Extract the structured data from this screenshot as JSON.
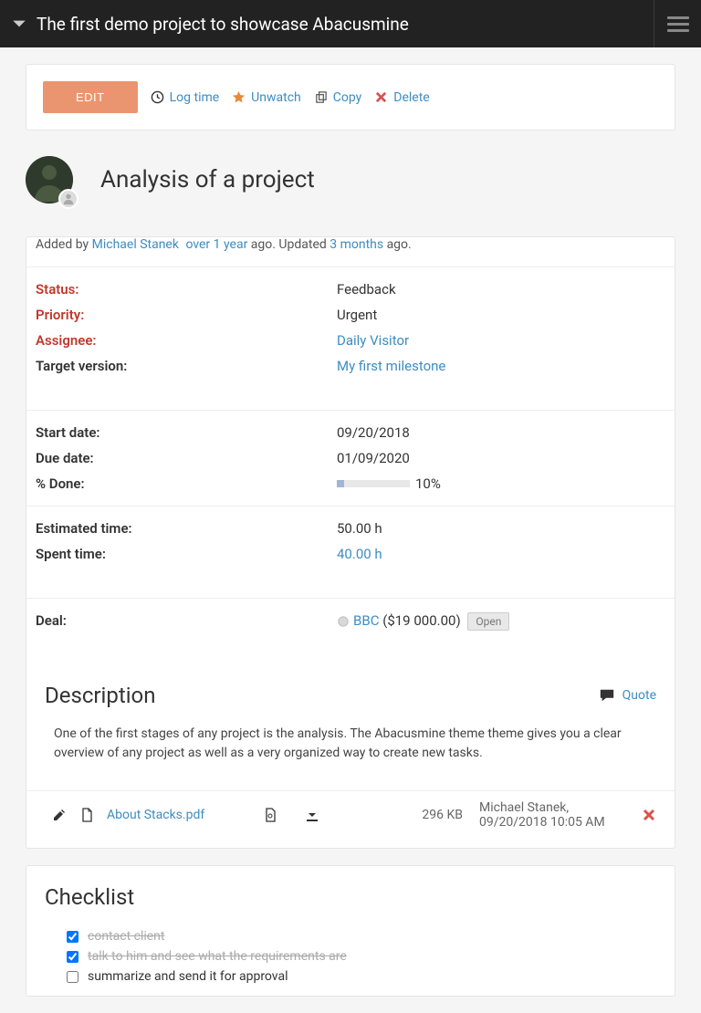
{
  "header": {
    "title": "The first demo project to showcase Abacusmine"
  },
  "toolbar": {
    "edit": "EDIT",
    "log_time": "Log time",
    "unwatch": "Unwatch",
    "copy": "Copy",
    "delete": "Delete"
  },
  "issue": {
    "title": "Analysis of a project",
    "added_by_prefix": "Added by ",
    "author": "Michael Stanek",
    "created": "over 1 year",
    "ago1": " ago. Updated ",
    "updated": "3 months",
    "ago2": " ago."
  },
  "attrs": {
    "status": {
      "label": "Status:",
      "value": "Feedback"
    },
    "priority": {
      "label": "Priority:",
      "value": "Urgent"
    },
    "assignee": {
      "label": "Assignee:",
      "value": "Daily Visitor"
    },
    "target_version": {
      "label": "Target version:",
      "value": "My first milestone"
    },
    "start_date": {
      "label": "Start date:",
      "value": "09/20/2018"
    },
    "due_date": {
      "label": "Due date:",
      "value": "01/09/2020"
    },
    "pct_done": {
      "label": "% Done:",
      "percent": 10,
      "text": "10%"
    },
    "estimated": {
      "label": "Estimated time:",
      "value": "50.00 h"
    },
    "spent": {
      "label": "Spent time:",
      "value": "40.00 h"
    },
    "deal": {
      "label": "Deal:",
      "link": "BBC",
      "amount": " ($19 000.00) ",
      "badge": "Open"
    }
  },
  "description": {
    "heading": "Description",
    "quote": "Quote",
    "body": "One of the first stages of any project is the analysis. The Abacusmine theme theme gives you a clear overview of any project as well as a very organized way to create new tasks."
  },
  "attachment": {
    "name": "About Stacks.pdf",
    "size": "296 KB",
    "author_time": "Michael Stanek, 09/20/2018 10:05 AM"
  },
  "checklist": {
    "heading": "Checklist",
    "items": [
      {
        "text": "contact client",
        "done": true
      },
      {
        "text": "talk to him and see what the requirements are",
        "done": true
      },
      {
        "text": "summarize and send it for approval",
        "done": false
      }
    ]
  }
}
